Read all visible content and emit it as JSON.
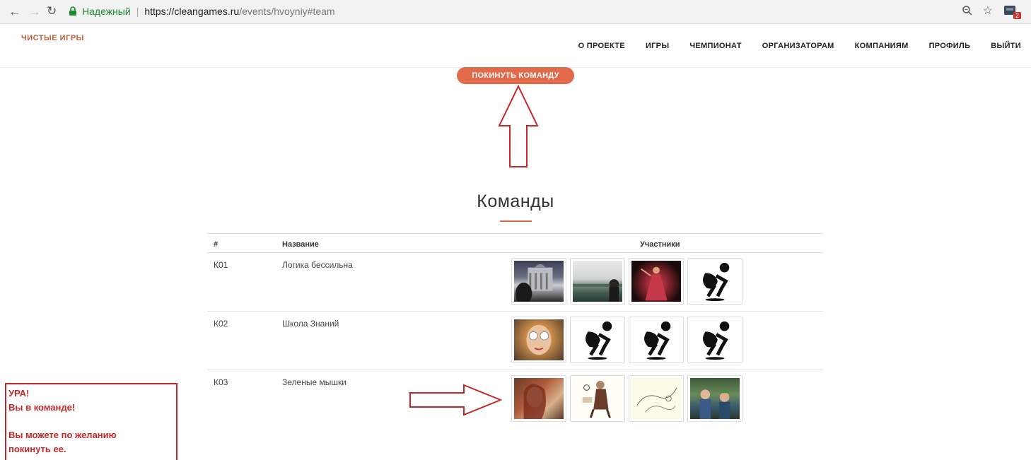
{
  "browser": {
    "secure_label": "Надежный",
    "url_host": "https://cleangames.ru",
    "url_path": "/events/hvoyniy#team",
    "extension_badge": "2"
  },
  "site": {
    "logo": "ЧИСТЫЕ ИГРЫ",
    "menu": [
      "О ПРОЕКТЕ",
      "ИГРЫ",
      "ЧЕМПИОНАТ",
      "ОРГАНИЗАТОРАМ",
      "КОМПАНИЯМ",
      "ПРОФИЛЬ",
      "ВЫЙТИ"
    ],
    "accent_color": "#e26a4a"
  },
  "leave_button": "ПОКИНУТЬ КОМАНДУ",
  "teams": {
    "title": "Команды",
    "headers": {
      "num": "#",
      "name": "Название",
      "members": "Участники"
    },
    "rows": [
      {
        "num": "К01",
        "name": "Логика бессильна",
        "members": [
          "photo",
          "photo",
          "photo",
          "default-avatar"
        ]
      },
      {
        "num": "К02",
        "name": "Школа Знаний",
        "members": [
          "photo",
          "default-avatar",
          "default-avatar",
          "default-avatar"
        ]
      },
      {
        "num": "К03",
        "name": "Зеленые мышки",
        "members": [
          "photo",
          "photo",
          "photo",
          "photo"
        ]
      }
    ]
  },
  "callout": {
    "line1": "УРА!",
    "line2": "Вы в команде!",
    "line3": "Вы можете по желанию",
    "line4": "покинуть ее.",
    "border_color": "#c62828"
  }
}
